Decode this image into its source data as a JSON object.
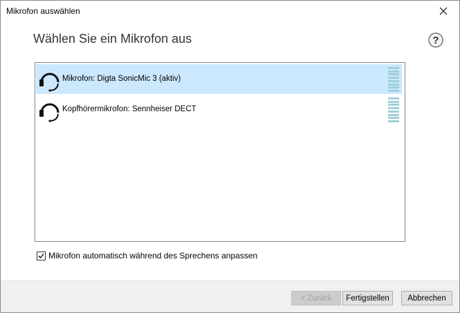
{
  "window": {
    "title": "Mikrofon auswählen"
  },
  "main": {
    "heading": "Wählen Sie ein Mikrofon aus"
  },
  "microphones": [
    {
      "label": "Mikrofon: Digta SonicMic 3 (aktiv)",
      "selected": true
    },
    {
      "label": "Kopfhörermikrofon: Sennheiser DECT",
      "selected": false
    }
  ],
  "options": {
    "auto_adjust_label": "Mikrofon automatisch während des Sprechens anpassen",
    "auto_adjust_checked": true
  },
  "footer": {
    "back_label": "< Zurück",
    "finish_label": "Fertigstellen",
    "cancel_label": "Abbrechen"
  },
  "colors": {
    "selection": "#cce8ff",
    "level_meter": "#9fd0d6",
    "footer_bg": "#f0f0f0"
  },
  "icons": {
    "close": "close-icon",
    "help": "help-icon",
    "microphone": "headset-icon"
  }
}
